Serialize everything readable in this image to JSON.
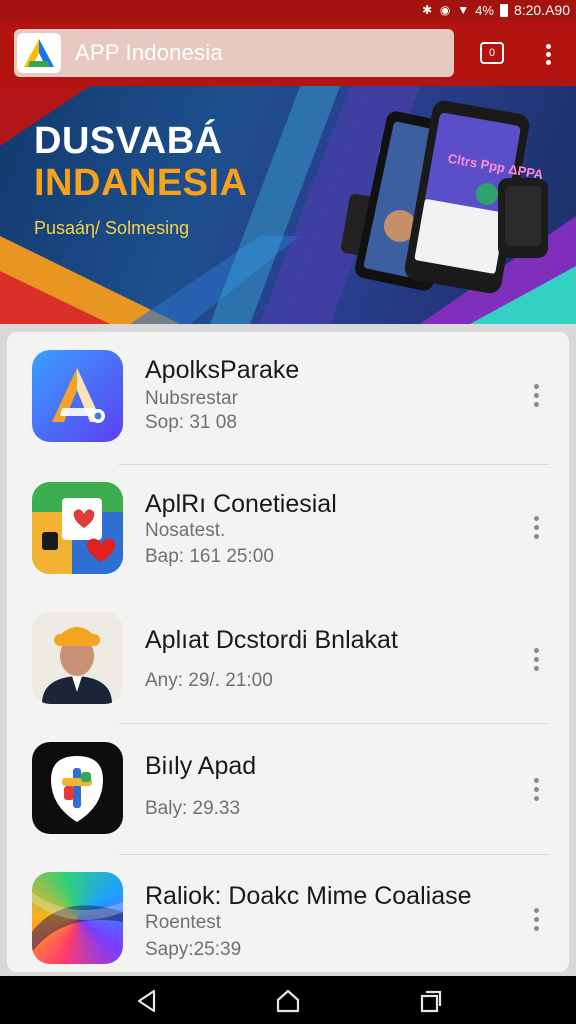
{
  "status_bar": {
    "time": "8:20.A90",
    "battery_text": "4%"
  },
  "app_bar": {
    "title": "APP Indonesia",
    "tabs_count": "0"
  },
  "hero": {
    "title_line1": "DUSVABÁ",
    "title_line2": "INDANESIA",
    "subtitle": "Pusaáη/ Solmesing",
    "phone_text": "Cltrs Ppp ΔPPA"
  },
  "apps": [
    {
      "name": "ApolksParake",
      "subtitle": "Nubsrestar",
      "meta": "Sop: 31 08",
      "icon": "app-a-icon"
    },
    {
      "name": "AplRı Conetiesial",
      "subtitle": "Nosatest.",
      "meta": "Bap: 161 25:00",
      "icon": "collage-heart-icon"
    },
    {
      "name": "Aplıat Dcstordi Bnlakat",
      "subtitle": "",
      "meta": "Any: 29/. 21:00",
      "icon": "person-avatar-icon"
    },
    {
      "name": "Biıly Apad",
      "subtitle": "",
      "meta": "Baly: 29.33",
      "icon": "shield-cross-icon"
    },
    {
      "name": "Raliok: Doakc Mime Coaliase",
      "subtitle": "Roentest",
      "meta": "Sapy:25:39",
      "icon": "swirl-gradient-icon"
    }
  ],
  "colors": {
    "accent": "#b3140f",
    "status": "#a3130f",
    "hero_orange": "#f7a21c",
    "hero_yellow": "#f6d246"
  }
}
